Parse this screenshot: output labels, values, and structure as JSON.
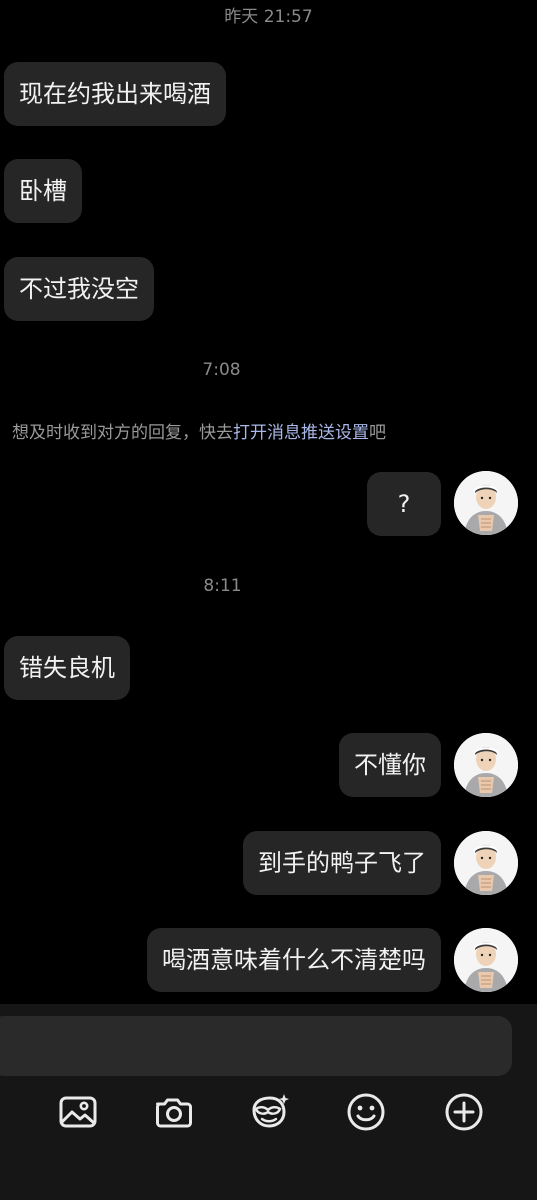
{
  "timestamps": {
    "t1": "昨天 21:57",
    "t2": "7:08",
    "t3": "8:11"
  },
  "messages": [
    {
      "side": "left",
      "text": "现在约我出来喝酒"
    },
    {
      "side": "left",
      "text": "卧槽"
    },
    {
      "side": "left",
      "text": "不过我没空"
    },
    {
      "side": "right",
      "text": "?"
    },
    {
      "side": "left",
      "text": "错失良机"
    },
    {
      "side": "right",
      "text": "不懂你"
    },
    {
      "side": "right",
      "text": "到手的鸭子飞了"
    },
    {
      "side": "right",
      "text": "喝酒意味着什么不清楚吗"
    }
  ],
  "notice": {
    "prefix": "想及时收到对方的回复，快去",
    "link": "打开消息推送设置",
    "suffix": "吧"
  },
  "toolbar": {
    "icons": [
      "image-icon",
      "camera-icon",
      "sticker-icon",
      "emoji-icon",
      "plus-icon"
    ]
  }
}
